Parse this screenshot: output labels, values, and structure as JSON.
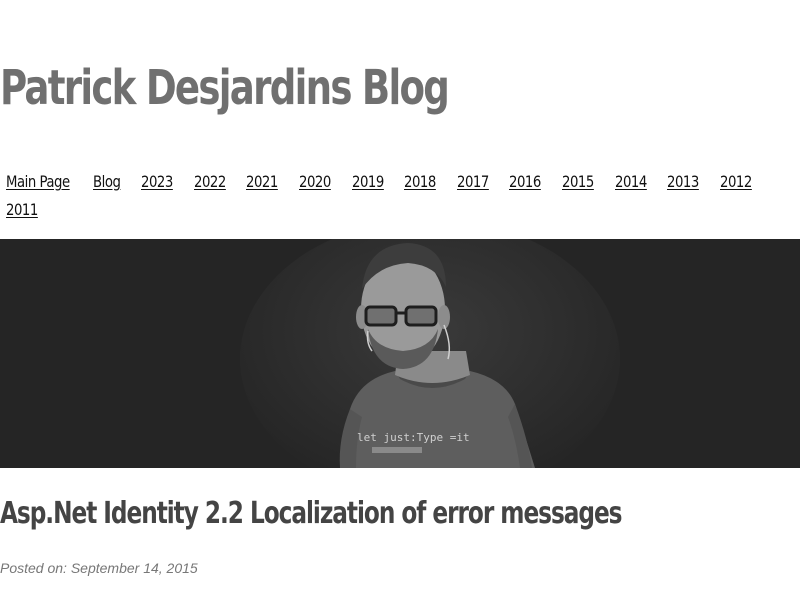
{
  "site": {
    "title": "Patrick Desjardins Blog"
  },
  "nav": {
    "row1": [
      "Main Page",
      "Blog",
      "2023",
      "2022",
      "2021",
      "2020",
      "2019",
      "2018",
      "2017",
      "2016",
      "2015",
      "2014",
      "2013",
      "2012"
    ],
    "row2": [
      "2011"
    ]
  },
  "hero": {
    "shirt_text": "let just:Type =it"
  },
  "post": {
    "title": "Asp.Net Identity 2.2 Localization of error messages",
    "posted_label": "Posted on:",
    "date": "September 14, 2015"
  }
}
